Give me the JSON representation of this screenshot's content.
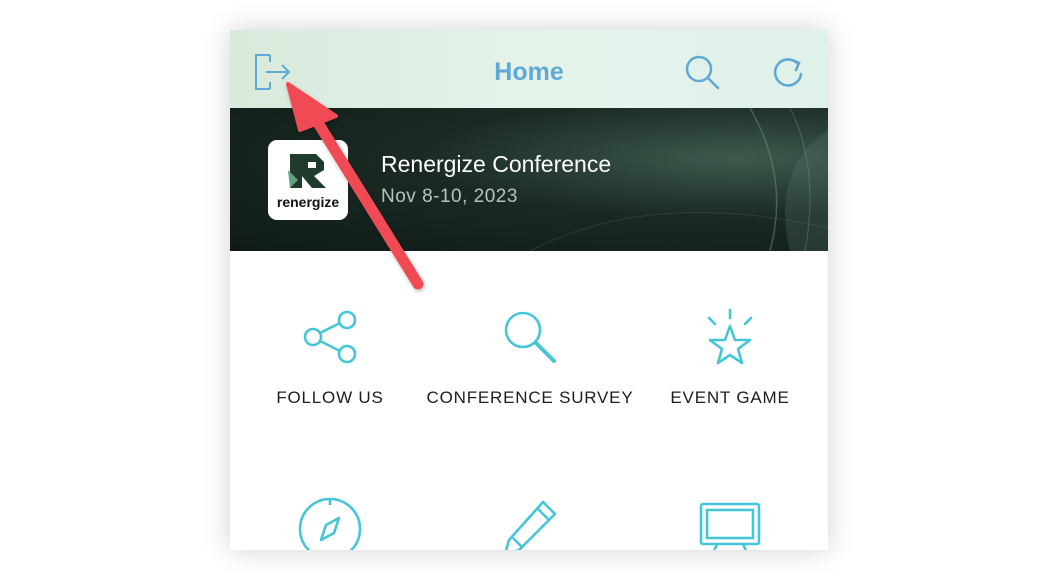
{
  "header": {
    "title": "Home",
    "icons": [
      "logout-icon",
      "search-icon",
      "refresh-icon"
    ],
    "title_color": "#5ea9d6"
  },
  "banner": {
    "logo_text": "renergize",
    "conference_name": "Renergize Conference",
    "conference_date": "Nov 8-10, 2023"
  },
  "menu": {
    "items": [
      {
        "label": "FOLLOW US",
        "icon": "share-icon"
      },
      {
        "label": "CONFERENCE SURVEY",
        "icon": "magnifier-icon"
      },
      {
        "label": "EVENT GAME",
        "icon": "star-icon"
      },
      {
        "label": "",
        "icon": "compass-icon"
      },
      {
        "label": "",
        "icon": "pencil-icon"
      },
      {
        "label": "",
        "icon": "presentation-board-icon"
      }
    ],
    "icon_color": "#45c6d8"
  },
  "annotation": {
    "arrow_color": "#f04b55"
  }
}
